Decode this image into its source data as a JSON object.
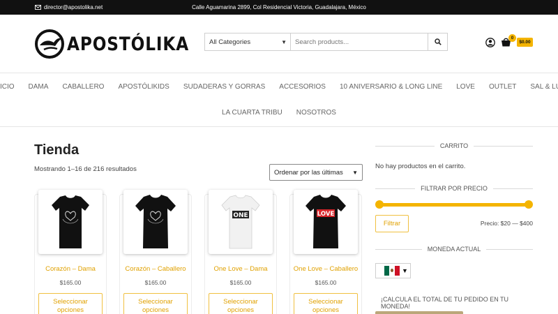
{
  "topbar": {
    "email": "director@apostolika.net",
    "address": "Calle Aguamarina 2899, Col Residencial Victoria, Guadalajara, México"
  },
  "header": {
    "logo_text": "APOSTÓLIKA",
    "search": {
      "category_selected": "All Categories",
      "placeholder": "Search products..."
    },
    "cart": {
      "count": "0",
      "total": "$0.00"
    }
  },
  "nav": {
    "row1": [
      "INICIO",
      "DAMA",
      "CABALLERO",
      "APOSTÓLIKIDS",
      "SUDADERAS Y GORRAS",
      "ACCESORIOS",
      "10 ANIVERSARIO & LONG LINE",
      "LOVE",
      "OUTLET",
      "SAL & LUZ"
    ],
    "row2": [
      "LA CUARTA TRIBU",
      "NOSOTROS"
    ]
  },
  "shop": {
    "title": "Tienda",
    "result_count": "Mostrando 1–16 de 216 resultados",
    "orderby": "Ordenar por las últimas",
    "products": [
      {
        "name": "Corazón – Dama",
        "price": "$165.00",
        "button": "Seleccionar opciones",
        "shirt_color": "#111111",
        "print": "heart"
      },
      {
        "name": "Corazón – Caballero",
        "price": "$165.00",
        "button": "Seleccionar opciones",
        "shirt_color": "#111111",
        "print": "heart"
      },
      {
        "name": "One Love – Dama",
        "price": "$165.00",
        "button": "Seleccionar opciones",
        "shirt_color": "#f2f2f2",
        "print": "one"
      },
      {
        "name": "One Love – Caballero",
        "price": "$165.00",
        "button": "Seleccionar opciones",
        "shirt_color": "#111111",
        "print": "love"
      }
    ]
  },
  "sidebar": {
    "cart_title": "CARRITO",
    "cart_empty": "No hay productos en el carrito.",
    "filter_title": "FILTRAR POR PRECIO",
    "filter_button": "Filtrar",
    "price_range": "Precio: $20 — $400",
    "currency_title": "MONEDA ACTUAL",
    "currency_flag": "mexico-flag",
    "calc_title": "¡CALCULA EL TOTAL DE TU PEDIDO EN TU MONEDA!"
  },
  "colors": {
    "accent": "#f4b400",
    "link": "#e0a100",
    "topbar": "#111111"
  }
}
